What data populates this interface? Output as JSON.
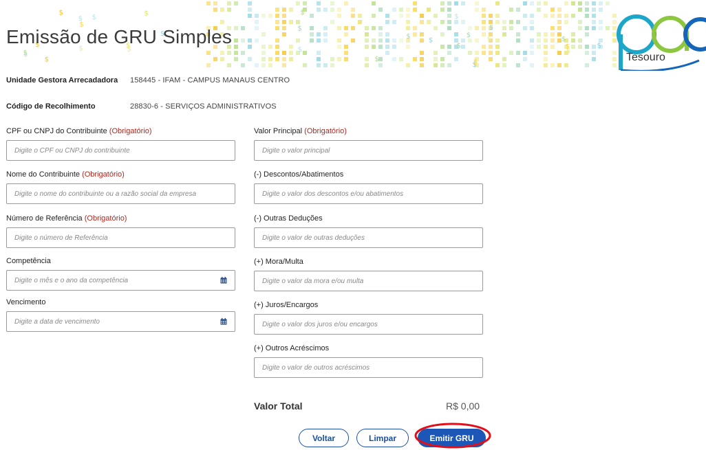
{
  "header": {
    "title": "Emissão de GRU Simples",
    "logo_text": "Tesouro",
    "logo_mark": "pag"
  },
  "info": {
    "ug_label": "Unidade Gestora Arrecadadora",
    "ug_value": "158445 - IFAM - CAMPUS MANAUS CENTRO",
    "codigo_label": "Código de Recolhimento",
    "codigo_value": "28830-6 - SERVIÇOS ADMINISTRATIVOS"
  },
  "required_text": "(Obrigatório)",
  "left_fields": {
    "cpf": {
      "label": "CPF ou CNPJ do Contribuinte",
      "placeholder": "Digite o CPF ou CNPJ do contribuinte"
    },
    "nome": {
      "label": "Nome do Contribuinte",
      "placeholder": "Digite o nome do contribuinte ou a razão social da empresa"
    },
    "referencia": {
      "label": "Número de Referência",
      "placeholder": "Digite o número de Referência"
    },
    "competencia": {
      "label": "Competência",
      "placeholder": "Digite o mês e o ano da competência",
      "icon": "calendar-icon"
    },
    "vencimento": {
      "label": "Vencimento",
      "placeholder": "Digite a data de vencimento",
      "icon": "calendar-icon"
    }
  },
  "right_fields": {
    "principal": {
      "label": "Valor Principal",
      "placeholder": "Digite o valor principal"
    },
    "descontos": {
      "label": "(-) Descontos/Abatimentos",
      "placeholder": "Digite o valor dos descontos e/ou abatimentos"
    },
    "deducoes": {
      "label": "(-) Outras Deduções",
      "placeholder": "Digite o valor de outras deduções"
    },
    "mora": {
      "label": "(+) Mora/Multa",
      "placeholder": "Digite o valor da mora e/ou multa"
    },
    "juros": {
      "label": "(+) Juros/Encargos",
      "placeholder": "Digite o valor dos juros e/ou encargos"
    },
    "acrescimos": {
      "label": "(+) Outros Acréscimos",
      "placeholder": "Digite o valor de outros acréscimos"
    }
  },
  "total": {
    "label": "Valor Total",
    "value": "R$ 0,00"
  },
  "buttons": {
    "voltar": "Voltar",
    "limpar": "Limpar",
    "emitir": "Emitir GRU"
  },
  "colors": {
    "primary": "#1c57b8",
    "required": "#b3261e",
    "highlight": "#e0101a"
  }
}
